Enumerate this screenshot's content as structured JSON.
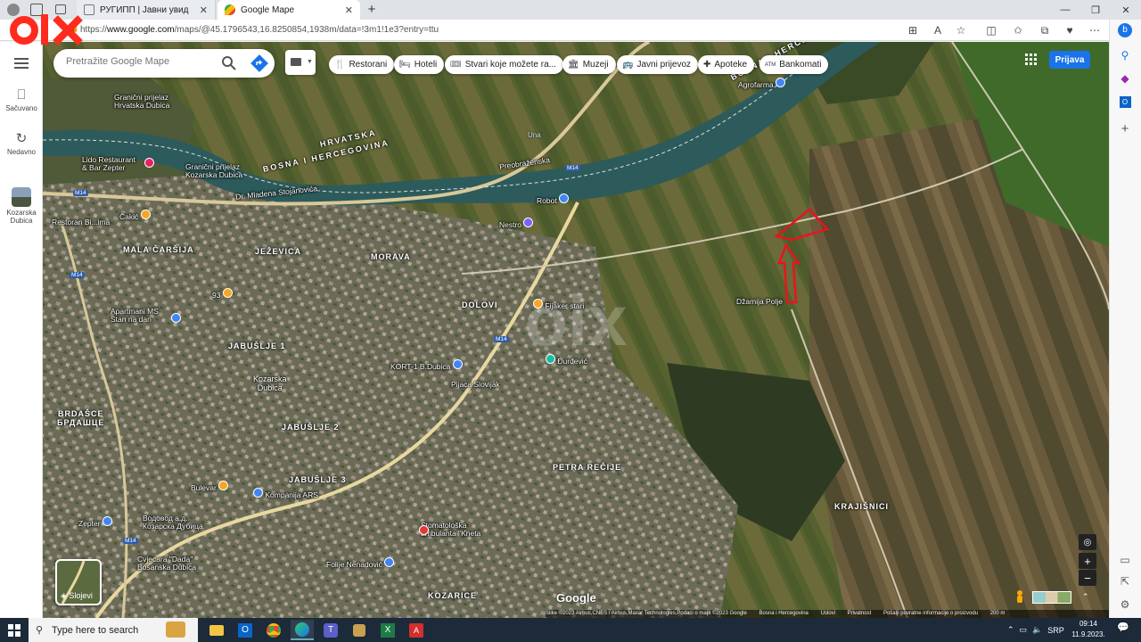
{
  "browser": {
    "tabs": [
      {
        "title": "РУГИПП | Јавни увид",
        "active": false
      },
      {
        "title": "Google Mape",
        "active": true
      }
    ],
    "url_prefix": "https://",
    "url_host": "www.google.com",
    "url_path": "/maps/@45.1796543,16.8250854,1938m/data=!3m1!1e3?entry=ttu",
    "new_tab_icon": "plus-icon"
  },
  "maps": {
    "search_placeholder": "Pretražite Google Mape",
    "rail": [
      {
        "label": "Sačuvano",
        "icon": "bookmark-icon"
      },
      {
        "label": "Nedavno",
        "icon": "history-icon"
      },
      {
        "label": "Kozarska Dubica",
        "icon": "place-thumb"
      }
    ],
    "chips": [
      {
        "label": "Restorani",
        "icon": "fork-knife-icon"
      },
      {
        "label": "Hoteli",
        "icon": "bed-icon"
      },
      {
        "label": "Stvari koje možete ra...",
        "icon": "ticket-icon"
      },
      {
        "label": "Muzeji",
        "icon": "museum-icon"
      },
      {
        "label": "Javni prijevoz",
        "icon": "bus-icon"
      },
      {
        "label": "Apoteke",
        "icon": "pharmacy-icon"
      },
      {
        "label": "Bankomati",
        "icon": "atm-icon"
      }
    ],
    "sign_in": "Prijava",
    "layers_label": "Slojevi",
    "google_logo": "Google",
    "footer": [
      "Slike ©2023 Airbus,CNES / Airbus,Maxar Technologies,Podaci o mapi ©2023 Google",
      "Bosna i Hercegovina",
      "Uslovi",
      "Privatnost",
      "Pošalji povratne informacije o proizvodu",
      "200 m"
    ],
    "labels": {
      "agrofarm": "Agrofarma",
      "granicni1": "Granični prijelaz\nHrvatska Dubica",
      "lido": "Lido Restaurant\n& Bar Zepter",
      "granicni2": "Granični prijelaz\nKozarska Dubica",
      "mladena": "Dr. Mladena Stojanovića",
      "preobrazenska": "Preobraženska",
      "robot": "Robot",
      "nestro": "Nestro",
      "cakic": "Čakić",
      "restoranterm": "Restoran Bi...ima",
      "apartmani": "Apartmani MS\nStan na dan",
      "n93": "93",
      "fijaker": "Fijaker stari",
      "kort": "KORT-1 B.Dubica",
      "pijaca": "Pijaca Slovijak",
      "durdevic": "Đurđević",
      "dzamija": "Džamija Polje",
      "bulevar": "Bulevar",
      "kompanija": "Kompanija ARS",
      "zepter": "Zepter",
      "vodovod": "Водовод а.д.\nКозарска Дубица",
      "stomatoloska": "Stomatološka\nambulanta \"Kneta",
      "cvjecara": "Cvjecara \"Dada\"\nBosanska Dubica",
      "folije": "Folije Nenadović",
      "una": "Una",
      "hrvatska": "HRVATSKA",
      "bih": "BOSNA I HERCEGOVINA",
      "bih2": "BOSNA I HERCEGOVINA"
    },
    "areas": {
      "mala_carsija": "MALA ČARŠIJA",
      "jezevica": "JEŽEVICA",
      "morava": "MORAVA",
      "dolovi": "DOLOVI",
      "jabuslje1": "JABUŠLJE 1",
      "kozarska": "Kozarska\nDubica",
      "jabuslje2": "JABUŠLJE 2",
      "jabuslje3": "JABUŠLJE 3",
      "brdasce": "BRDAŠCE\nБРДАШЦЕ",
      "petra": "PETRA REČIJE",
      "krajisnici": "KRAJIŠNICI",
      "kozarice": "KOZARICE"
    },
    "road_shields": [
      "M14",
      "M14",
      "M14",
      "M14",
      "M14"
    ]
  },
  "taskbar": {
    "search_placeholder": "Type here to search",
    "lang": "SRP",
    "time": "09:14",
    "date": "11.9.2023.",
    "apps": [
      "briefcase-icon",
      "folder-icon",
      "outlook-icon",
      "chrome-icon",
      "edge-icon",
      "teams-icon",
      "bag-icon",
      "excel-icon",
      "acrobat-icon"
    ]
  },
  "colors": {
    "accent": "#1a73e8",
    "olx_red": "#ff2b1c",
    "annotation_red": "#e8141d"
  }
}
